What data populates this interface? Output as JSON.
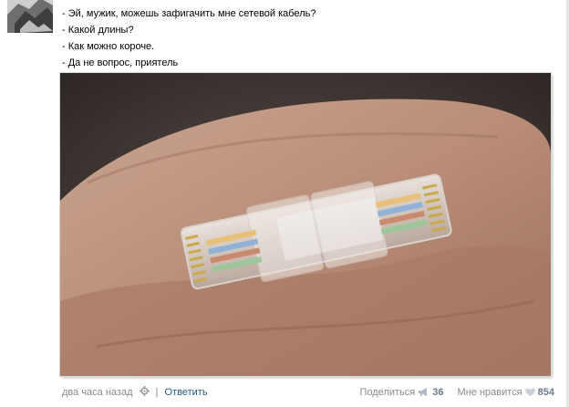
{
  "post": {
    "lines": [
      "- Эй, мужик, можешь зафигачить мне сетевой кабель?",
      "- Какой длины?",
      "- Как можно короче.",
      "- Да не вопрос, приятель"
    ]
  },
  "photo": {
    "description_icon": "photo-icon"
  },
  "footer": {
    "time": "два часа назад",
    "separator": "|",
    "reply_label": "Ответить",
    "share_label": "Поделиться",
    "share_count": "36",
    "like_label": "Мне нравится",
    "like_count": "854"
  },
  "colors": {
    "link": "#2b587a",
    "muted": "#8a8a8a",
    "count": "#6b7d91"
  }
}
